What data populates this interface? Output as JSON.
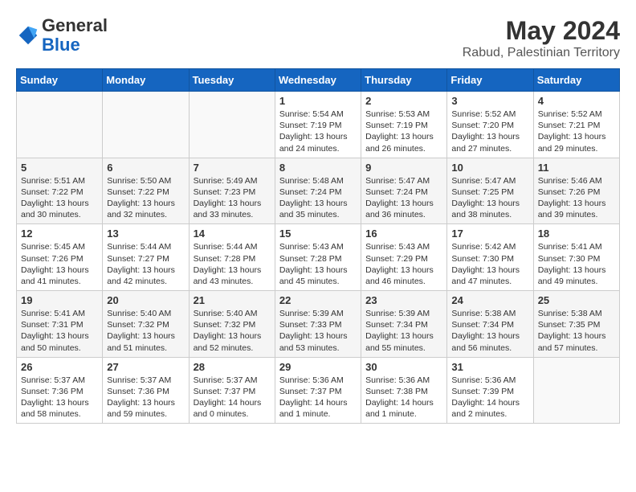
{
  "header": {
    "logo_line1": "General",
    "logo_line2": "Blue",
    "month_year": "May 2024",
    "location": "Rabud, Palestinian Territory"
  },
  "weekdays": [
    "Sunday",
    "Monday",
    "Tuesday",
    "Wednesday",
    "Thursday",
    "Friday",
    "Saturday"
  ],
  "weeks": [
    [
      {
        "day": "",
        "info": ""
      },
      {
        "day": "",
        "info": ""
      },
      {
        "day": "",
        "info": ""
      },
      {
        "day": "1",
        "info": "Sunrise: 5:54 AM\nSunset: 7:19 PM\nDaylight: 13 hours\nand 24 minutes."
      },
      {
        "day": "2",
        "info": "Sunrise: 5:53 AM\nSunset: 7:19 PM\nDaylight: 13 hours\nand 26 minutes."
      },
      {
        "day": "3",
        "info": "Sunrise: 5:52 AM\nSunset: 7:20 PM\nDaylight: 13 hours\nand 27 minutes."
      },
      {
        "day": "4",
        "info": "Sunrise: 5:52 AM\nSunset: 7:21 PM\nDaylight: 13 hours\nand 29 minutes."
      }
    ],
    [
      {
        "day": "5",
        "info": "Sunrise: 5:51 AM\nSunset: 7:22 PM\nDaylight: 13 hours\nand 30 minutes."
      },
      {
        "day": "6",
        "info": "Sunrise: 5:50 AM\nSunset: 7:22 PM\nDaylight: 13 hours\nand 32 minutes."
      },
      {
        "day": "7",
        "info": "Sunrise: 5:49 AM\nSunset: 7:23 PM\nDaylight: 13 hours\nand 33 minutes."
      },
      {
        "day": "8",
        "info": "Sunrise: 5:48 AM\nSunset: 7:24 PM\nDaylight: 13 hours\nand 35 minutes."
      },
      {
        "day": "9",
        "info": "Sunrise: 5:47 AM\nSunset: 7:24 PM\nDaylight: 13 hours\nand 36 minutes."
      },
      {
        "day": "10",
        "info": "Sunrise: 5:47 AM\nSunset: 7:25 PM\nDaylight: 13 hours\nand 38 minutes."
      },
      {
        "day": "11",
        "info": "Sunrise: 5:46 AM\nSunset: 7:26 PM\nDaylight: 13 hours\nand 39 minutes."
      }
    ],
    [
      {
        "day": "12",
        "info": "Sunrise: 5:45 AM\nSunset: 7:26 PM\nDaylight: 13 hours\nand 41 minutes."
      },
      {
        "day": "13",
        "info": "Sunrise: 5:44 AM\nSunset: 7:27 PM\nDaylight: 13 hours\nand 42 minutes."
      },
      {
        "day": "14",
        "info": "Sunrise: 5:44 AM\nSunset: 7:28 PM\nDaylight: 13 hours\nand 43 minutes."
      },
      {
        "day": "15",
        "info": "Sunrise: 5:43 AM\nSunset: 7:28 PM\nDaylight: 13 hours\nand 45 minutes."
      },
      {
        "day": "16",
        "info": "Sunrise: 5:43 AM\nSunset: 7:29 PM\nDaylight: 13 hours\nand 46 minutes."
      },
      {
        "day": "17",
        "info": "Sunrise: 5:42 AM\nSunset: 7:30 PM\nDaylight: 13 hours\nand 47 minutes."
      },
      {
        "day": "18",
        "info": "Sunrise: 5:41 AM\nSunset: 7:30 PM\nDaylight: 13 hours\nand 49 minutes."
      }
    ],
    [
      {
        "day": "19",
        "info": "Sunrise: 5:41 AM\nSunset: 7:31 PM\nDaylight: 13 hours\nand 50 minutes."
      },
      {
        "day": "20",
        "info": "Sunrise: 5:40 AM\nSunset: 7:32 PM\nDaylight: 13 hours\nand 51 minutes."
      },
      {
        "day": "21",
        "info": "Sunrise: 5:40 AM\nSunset: 7:32 PM\nDaylight: 13 hours\nand 52 minutes."
      },
      {
        "day": "22",
        "info": "Sunrise: 5:39 AM\nSunset: 7:33 PM\nDaylight: 13 hours\nand 53 minutes."
      },
      {
        "day": "23",
        "info": "Sunrise: 5:39 AM\nSunset: 7:34 PM\nDaylight: 13 hours\nand 55 minutes."
      },
      {
        "day": "24",
        "info": "Sunrise: 5:38 AM\nSunset: 7:34 PM\nDaylight: 13 hours\nand 56 minutes."
      },
      {
        "day": "25",
        "info": "Sunrise: 5:38 AM\nSunset: 7:35 PM\nDaylight: 13 hours\nand 57 minutes."
      }
    ],
    [
      {
        "day": "26",
        "info": "Sunrise: 5:37 AM\nSunset: 7:36 PM\nDaylight: 13 hours\nand 58 minutes."
      },
      {
        "day": "27",
        "info": "Sunrise: 5:37 AM\nSunset: 7:36 PM\nDaylight: 13 hours\nand 59 minutes."
      },
      {
        "day": "28",
        "info": "Sunrise: 5:37 AM\nSunset: 7:37 PM\nDaylight: 14 hours\nand 0 minutes."
      },
      {
        "day": "29",
        "info": "Sunrise: 5:36 AM\nSunset: 7:37 PM\nDaylight: 14 hours\nand 1 minute."
      },
      {
        "day": "30",
        "info": "Sunrise: 5:36 AM\nSunset: 7:38 PM\nDaylight: 14 hours\nand 1 minute."
      },
      {
        "day": "31",
        "info": "Sunrise: 5:36 AM\nSunset: 7:39 PM\nDaylight: 14 hours\nand 2 minutes."
      },
      {
        "day": "",
        "info": ""
      }
    ]
  ]
}
